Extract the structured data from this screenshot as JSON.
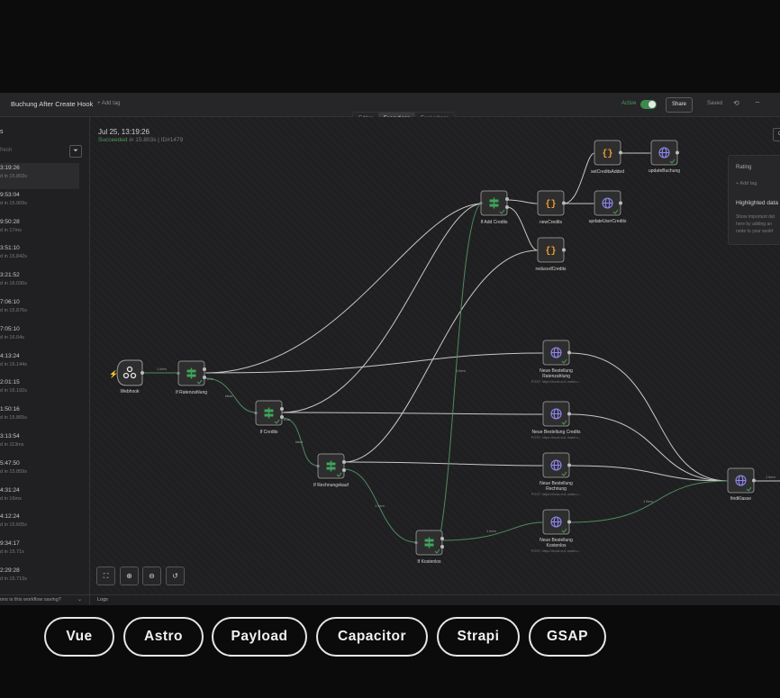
{
  "header": {
    "workflow_name": "Buchung After Create Hook",
    "add_tag": "+ Add tag",
    "active_label": "Active",
    "share_label": "Share",
    "saved_label": "Saved",
    "tabs": [
      "Editor",
      "Executions",
      "Evaluations"
    ],
    "active_tab": "Executions"
  },
  "sidebar": {
    "title": "s",
    "auto_refresh": "fresh",
    "executions": [
      {
        "time": "3:19:26",
        "duration": "d in 15.803s"
      },
      {
        "time": "9:53:04",
        "duration": "d in 15.909s"
      },
      {
        "time": "9:50:28",
        "duration": "d in 17ms"
      },
      {
        "time": "3:51:10",
        "duration": "d in 15.842s"
      },
      {
        "time": "3:21:52",
        "duration": "d in 16.036s"
      },
      {
        "time": "7:06:10",
        "duration": "d in 15.876s"
      },
      {
        "time": "7:05:10",
        "duration": "d in 16.04s"
      },
      {
        "time": "4:13:24",
        "duration": "d in 16.144s"
      },
      {
        "time": "2:01:15",
        "duration": "d in 16.192s"
      },
      {
        "time": "1:50:16",
        "duration": "d in 15.865s"
      },
      {
        "time": "3:13:54",
        "duration": "d in 113ms"
      },
      {
        "time": "5:47:50",
        "duration": "d in 15.859s"
      },
      {
        "time": "4:31:24",
        "duration": "d in 16ms"
      },
      {
        "time": "4:12:24",
        "duration": "d in 15.605s"
      },
      {
        "time": "9:34:17",
        "duration": "d in 15.71s"
      },
      {
        "time": "2:29:28",
        "duration": "d in 15.719s"
      }
    ],
    "footer_question": "ons is this workflow saving?"
  },
  "execution": {
    "date": "Jul 25, 13:19:26",
    "status": "Succeeded",
    "status_rest": " in 15.803s | ID#1479"
  },
  "right_panel": {
    "rating": "Rating",
    "add_tag": "+ Add tag",
    "highlighted": "Highlighted data",
    "desc_lines": [
      "Show important dat",
      "here by adding an",
      "node to your workf"
    ]
  },
  "logs_label": "Logs",
  "nodes": {
    "webhook": "Webhook",
    "if_ratenzahlung": "If Ratenzahlung",
    "if_credits": "If Credits",
    "if_rechnungskauf": "If Rechnungskauf",
    "if_kostenlos": "If Kostenlos",
    "if_add_credits": "If Add Credits",
    "new_credits": "newCredits",
    "reduced_credits": "reducedCredits",
    "set_credits_added": "setCreditsAdded",
    "update_buchung": "updateBuchung",
    "update_user_credits": "updateUserCredits",
    "neue_ratenzahlung": [
      "Neue Bestellung",
      "Ratenzahlung"
    ],
    "neue_credits": "Neue Bestellung Credits",
    "neue_rechnung": [
      "Neue Bestellung",
      "Rechnung"
    ],
    "neue_kostenlos": [
      "Neue Bestellung",
      "Kostenlos"
    ],
    "find_klasse": "findKlasse",
    "post_url": "POST: https://hook.eu1.make.c..."
  },
  "edge_labels": {
    "one_item": "1 item",
    "true": "true",
    "false": "false"
  },
  "pills": [
    "Vue",
    "Astro",
    "Payload",
    "Capacitor",
    "Strapi",
    "GSAP"
  ],
  "colors": {
    "success_green": "#4c9a5c",
    "edge_gray": "#c8c8c8",
    "edge_green": "#4f8a5f",
    "if_icon_green": "#3fa45b",
    "code_orange": "#f0a030",
    "http_purple": "#8f87f1"
  }
}
